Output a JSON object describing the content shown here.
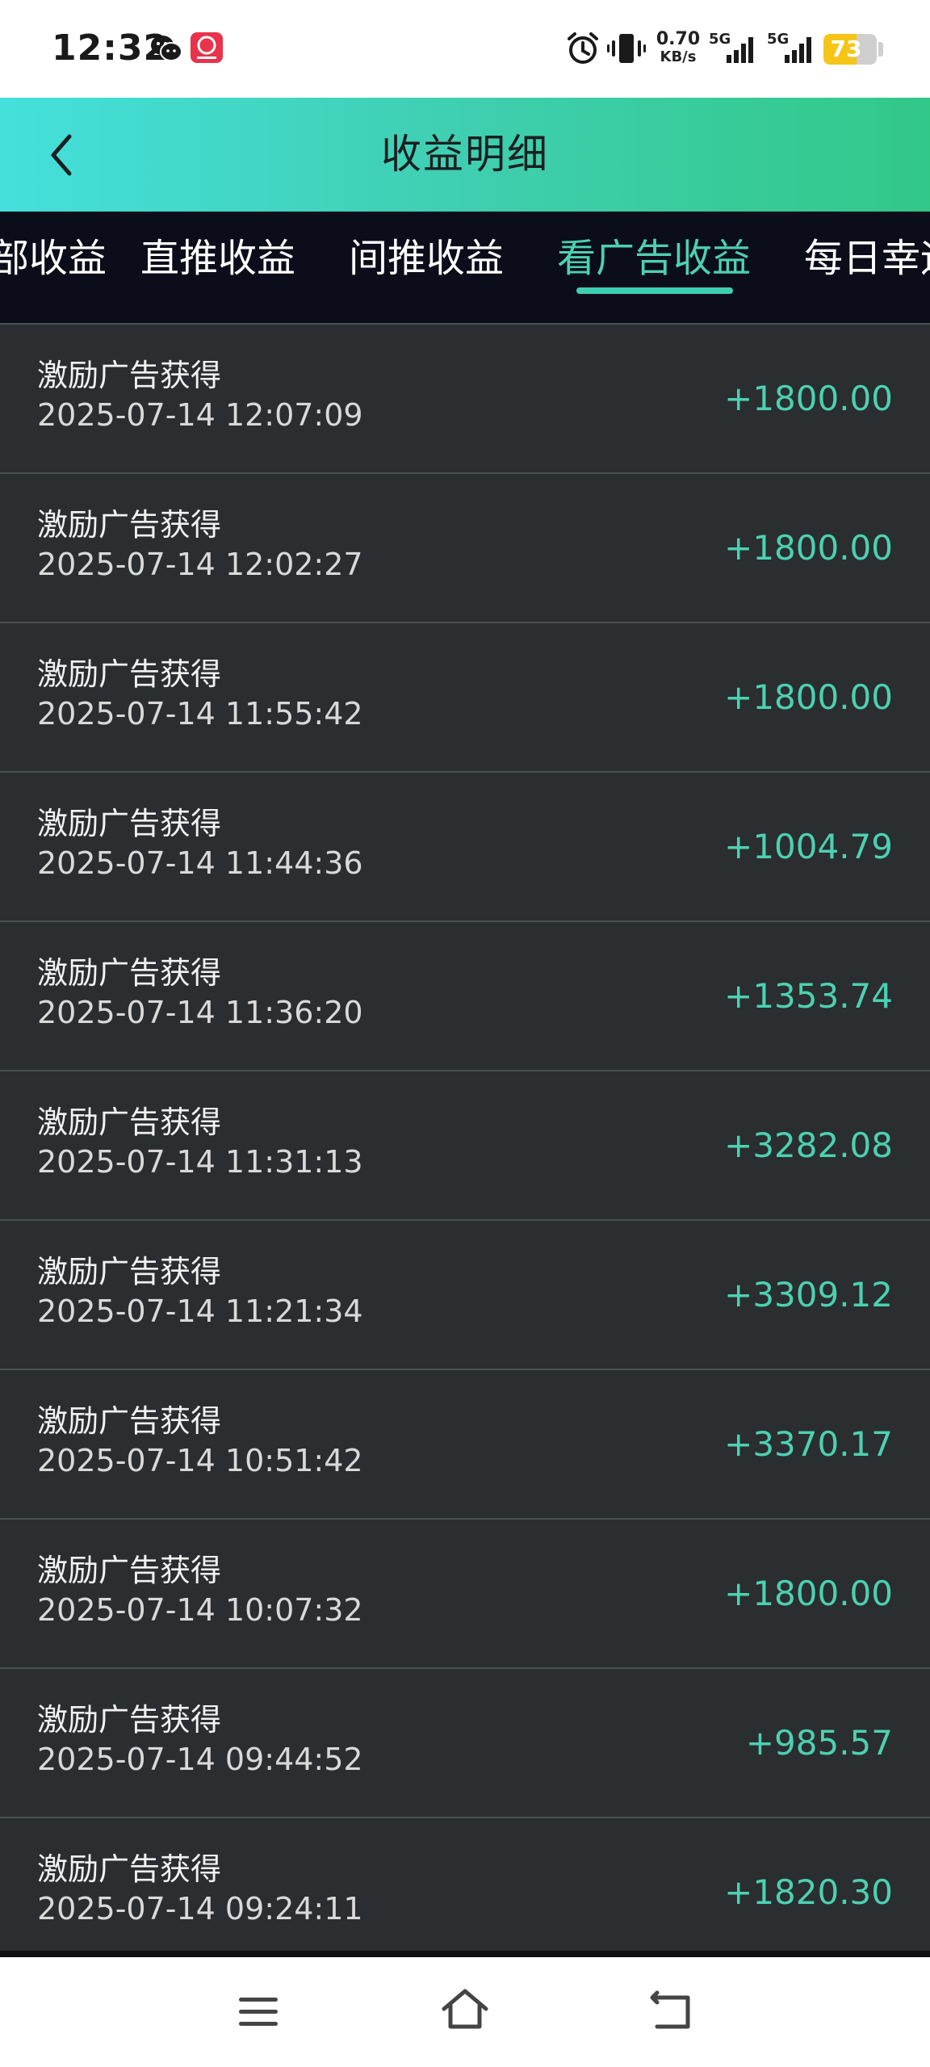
{
  "status_bar": {
    "time": "12:32",
    "net_speed_value": "0.70",
    "net_speed_unit": "KB/s",
    "signal1_label": "5G",
    "signal2_label": "5G",
    "battery_level": "73",
    "battery_fraction": 0.73
  },
  "header": {
    "title": "收益明细"
  },
  "tabs": [
    {
      "label": "部收益",
      "active": false
    },
    {
      "label": "直推收益",
      "active": false
    },
    {
      "label": "间推收益",
      "active": false
    },
    {
      "label": "看广告收益",
      "active": true
    },
    {
      "label": "每日幸运",
      "active": false
    }
  ],
  "records": [
    {
      "title": "激励广告获得",
      "time": "2025-07-14 12:07:09",
      "amount": "+1800.00"
    },
    {
      "title": "激励广告获得",
      "time": "2025-07-14 12:02:27",
      "amount": "+1800.00"
    },
    {
      "title": "激励广告获得",
      "time": "2025-07-14 11:55:42",
      "amount": "+1800.00"
    },
    {
      "title": "激励广告获得",
      "time": "2025-07-14 11:44:36",
      "amount": "+1004.79"
    },
    {
      "title": "激励广告获得",
      "time": "2025-07-14 11:36:20",
      "amount": "+1353.74"
    },
    {
      "title": "激励广告获得",
      "time": "2025-07-14 11:31:13",
      "amount": "+3282.08"
    },
    {
      "title": "激励广告获得",
      "time": "2025-07-14 11:21:34",
      "amount": "+3309.12"
    },
    {
      "title": "激励广告获得",
      "time": "2025-07-14 10:51:42",
      "amount": "+3370.17"
    },
    {
      "title": "激励广告获得",
      "time": "2025-07-14 10:07:32",
      "amount": "+1800.00"
    },
    {
      "title": "激励广告获得",
      "time": "2025-07-14 09:44:52",
      "amount": "+985.57"
    },
    {
      "title": "激励广告获得",
      "time": "2025-07-14 09:24:11",
      "amount": "+1820.30"
    }
  ],
  "colors": {
    "accent": "#4cd1b0",
    "background": "#2a2e30",
    "tab_bar": "#0b0d1a"
  }
}
